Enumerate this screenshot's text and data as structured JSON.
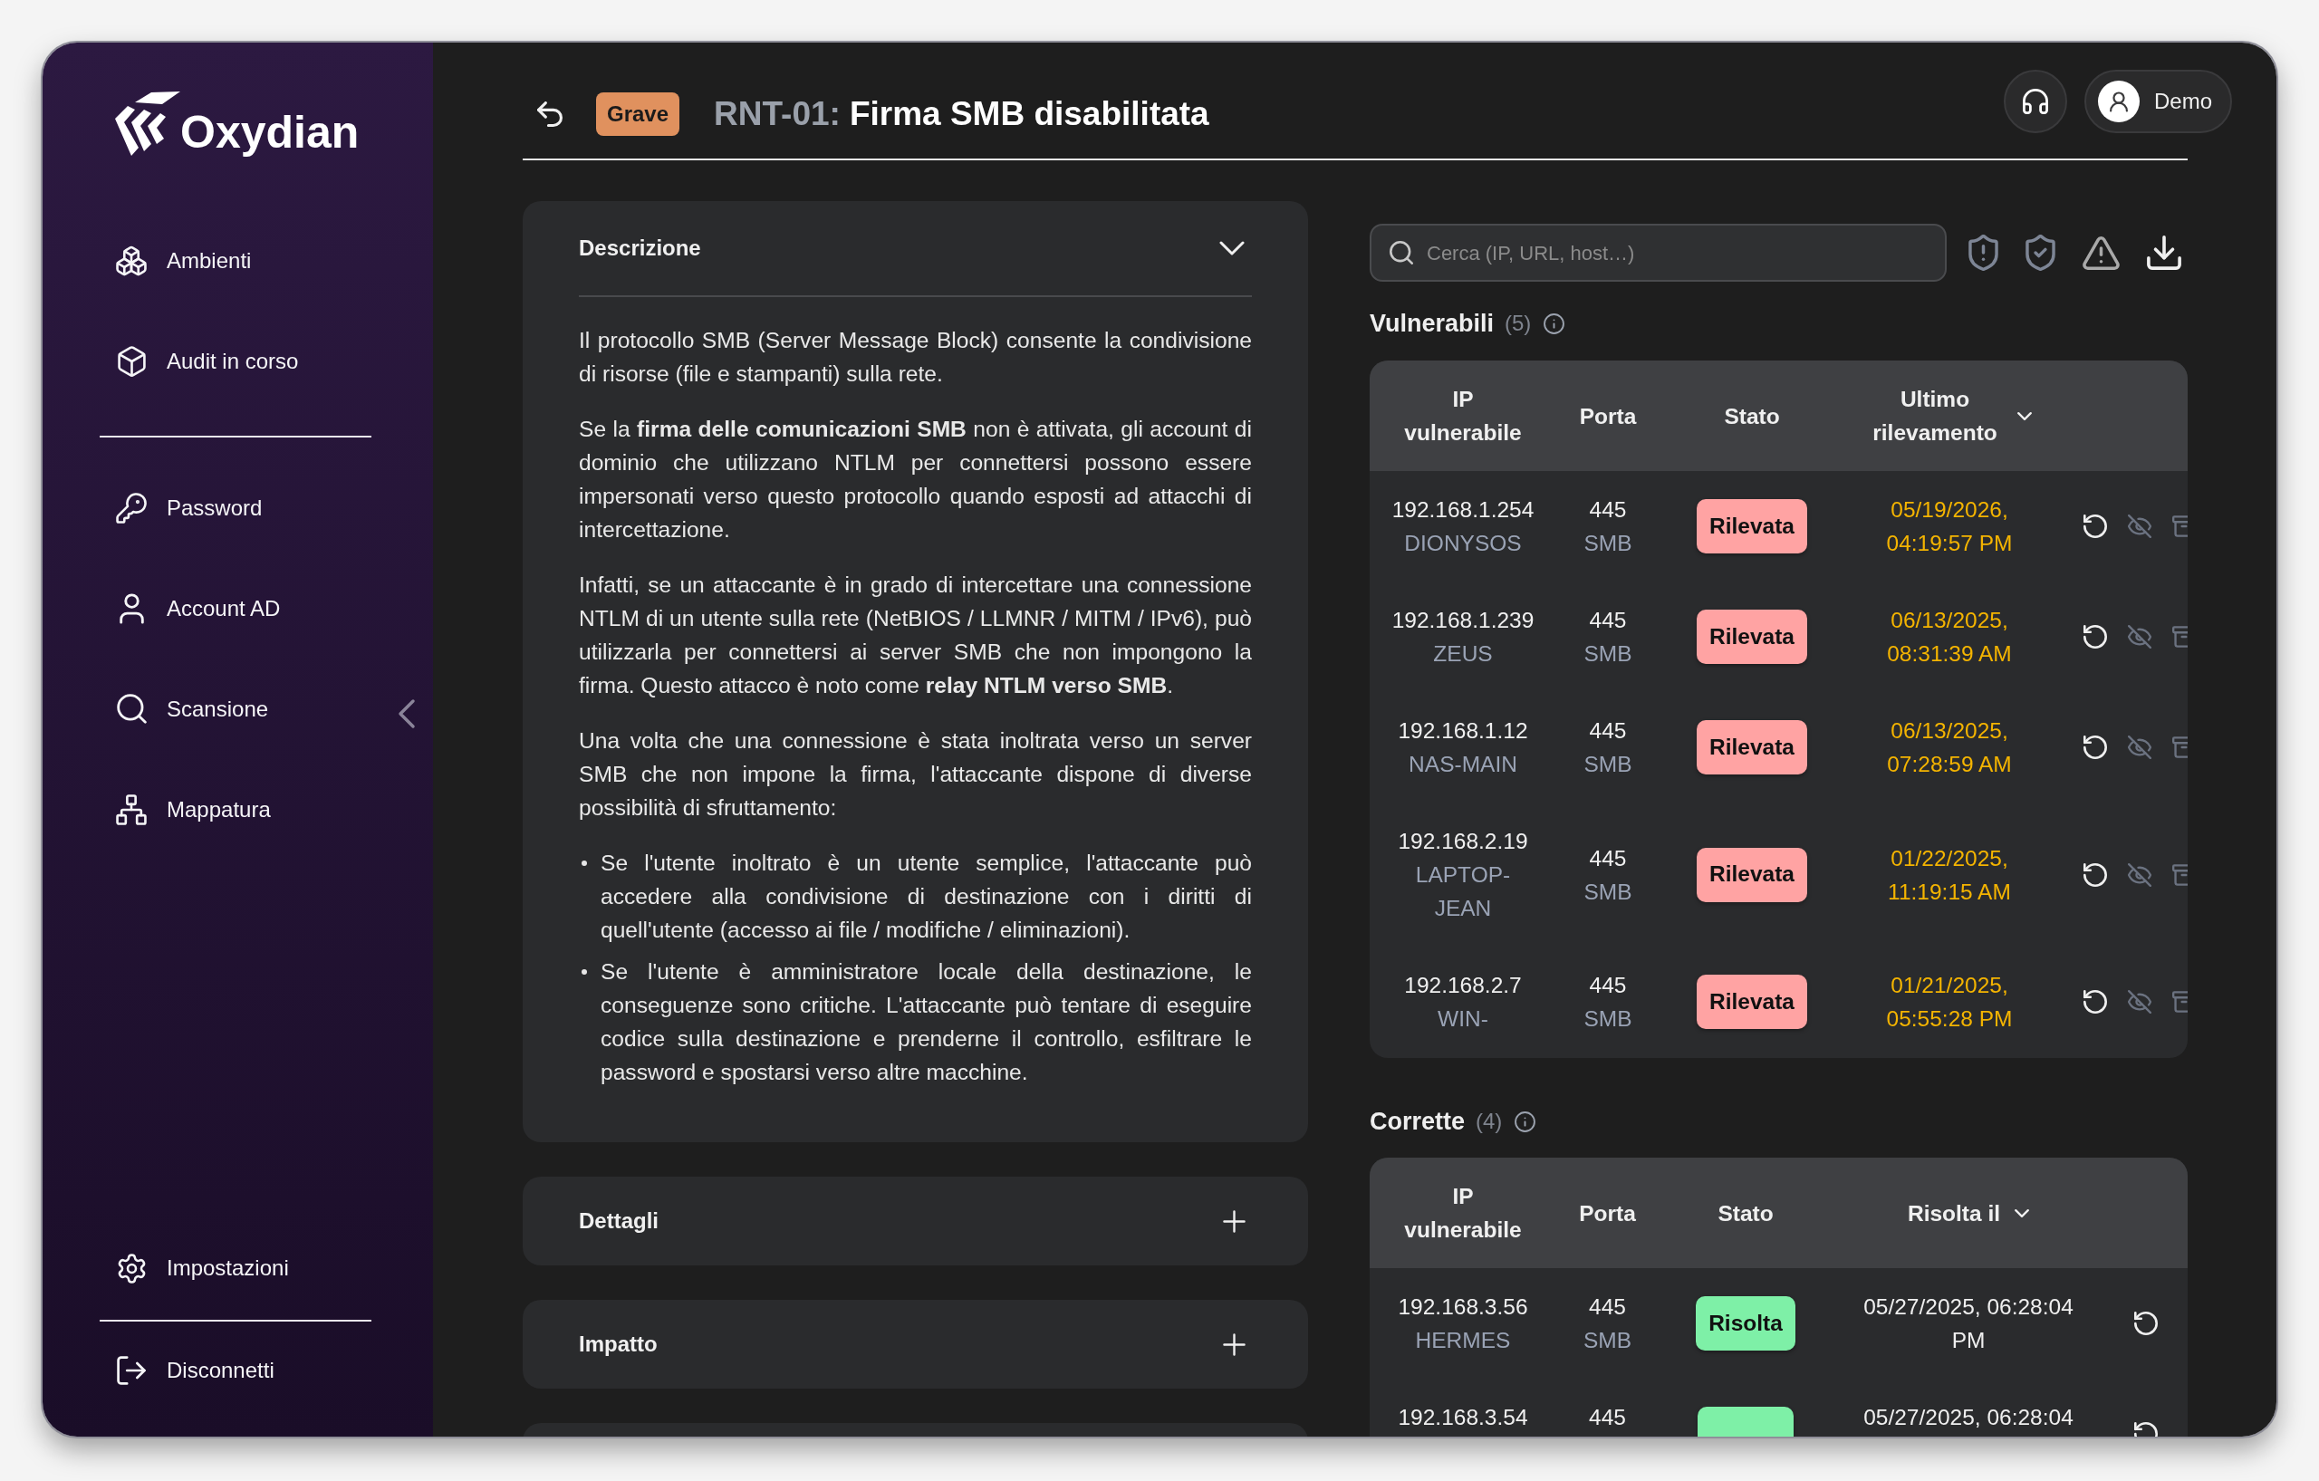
{
  "sidebar": {
    "logo": "Oxydian",
    "nav_groups": [
      {
        "items": [
          {
            "label": "Ambienti"
          },
          {
            "label": "Audit in corso"
          }
        ]
      },
      {
        "items": [
          {
            "label": "Password"
          },
          {
            "label": "Account AD"
          },
          {
            "label": "Scansione"
          },
          {
            "label": "Mappatura"
          }
        ]
      }
    ],
    "footer_items": [
      {
        "label": "Impostazioni"
      },
      {
        "label": "Disconnetti"
      }
    ]
  },
  "header": {
    "severity": "Grave",
    "code": "RNT-01:",
    "title": "Firma SMB disabilitata",
    "user": "Demo"
  },
  "sections": [
    {
      "title": "Descrizione",
      "expanded": true,
      "paragraphs": [
        "Il protocollo SMB (Server Message Block) consente la condivisione di risorse (file e stampanti) sulla rete.",
        "Se la **firma delle comunicazioni SMB** non è attivata, gli account di dominio che utilizzano NTLM per connettersi possono essere impersonati verso questo protocollo quando esposti ad attacchi di intercettazione.",
        "Infatti, se un attaccante è in grado di intercettare una connessione NTLM di un utente sulla rete (NetBIOS / LLMNR / MITM / IPv6), può utilizzarla per connettersi ai server SMB che non impongono la firma. Questo attacco è noto come **relay NTLM verso SMB**.",
        "Una volta che una connessione è stata inoltrata verso un server SMB che non impone la firma, l'attaccante dispone di diverse possibilità di sfruttamento:"
      ],
      "bullets": [
        "Se l'utente inoltrato è un utente semplice, l'attaccante può accedere alla condivisione di destinazione con i diritti di quell'utente (accesso ai file / modifiche / eliminazioni).",
        "Se l'utente è amministratore locale della destinazione, le conseguenze sono critiche. L'attaccante può tentare di eseguire codice sulla destinazione e prenderne il controllo, esfiltrare le password e spostarsi verso altre macchine."
      ]
    },
    {
      "title": "Dettagli",
      "expanded": false
    },
    {
      "title": "Impatto",
      "expanded": false
    }
  ],
  "search": {
    "placeholder": "Cerca (IP, URL, host…)"
  },
  "tables": [
    {
      "kind": "vulnerable",
      "title": "Vulnerabili",
      "count": "(5)",
      "columns": [
        {
          "label": "IP vulnerabile",
          "sorted": false
        },
        {
          "label": "Porta",
          "sorted": false
        },
        {
          "label": "Stato",
          "sorted": false
        },
        {
          "label": "Ultimo rilevamento",
          "sorted": true
        }
      ],
      "rows": [
        {
          "ip": "192.168.1.254",
          "host": "DIONYSOS",
          "port": "445",
          "protocol": "SMB",
          "status": {
            "label": "Rilevata",
            "color": "#ffa3a3"
          },
          "date": "05/19/2026, 04:19:57 PM"
        },
        {
          "ip": "192.168.1.239",
          "host": "ZEUS",
          "port": "445",
          "protocol": "SMB",
          "status": {
            "label": "Rilevata",
            "color": "#ffa3a3"
          },
          "date": "06/13/2025, 08:31:39 AM"
        },
        {
          "ip": "192.168.1.12",
          "host": "NAS-MAIN",
          "port": "445",
          "protocol": "SMB",
          "status": {
            "label": "Rilevata",
            "color": "#ffa3a3"
          },
          "date": "06/13/2025, 07:28:59 AM"
        },
        {
          "ip": "192.168.2.19",
          "host": "LAPTOP-JEAN",
          "port": "445",
          "protocol": "SMB",
          "status": {
            "label": "Rilevata",
            "color": "#ffa3a3"
          },
          "date": "01/22/2025, 11:19:15 AM"
        },
        {
          "ip": "192.168.2.7",
          "host": "WIN-",
          "port": "445",
          "protocol": "SMB",
          "status": {
            "label": "Rilevata",
            "color": "#ffa3a3"
          },
          "date": "01/21/2025, 05:55:28 PM"
        }
      ]
    },
    {
      "kind": "resolved",
      "title": "Corrette",
      "count": "(4)",
      "columns": [
        {
          "label": "IP vulnerabile",
          "sorted": false
        },
        {
          "label": "Porta",
          "sorted": false
        },
        {
          "label": "Stato",
          "sorted": false
        },
        {
          "label": "Risolta il",
          "sorted": true
        }
      ],
      "rows": [
        {
          "ip": "192.168.3.56",
          "host": "HERMES",
          "port": "445",
          "protocol": "SMB",
          "status": {
            "label": "Risolta",
            "color": "#7ef0a7"
          },
          "date": "05/27/2025, 06:28:04 PM"
        },
        {
          "ip": "192.168.3.54",
          "port": "445",
          "status": {
            "color": "#7ef0a7"
          },
          "date": "05/27/2025, 06:28:04"
        }
      ]
    }
  ]
}
